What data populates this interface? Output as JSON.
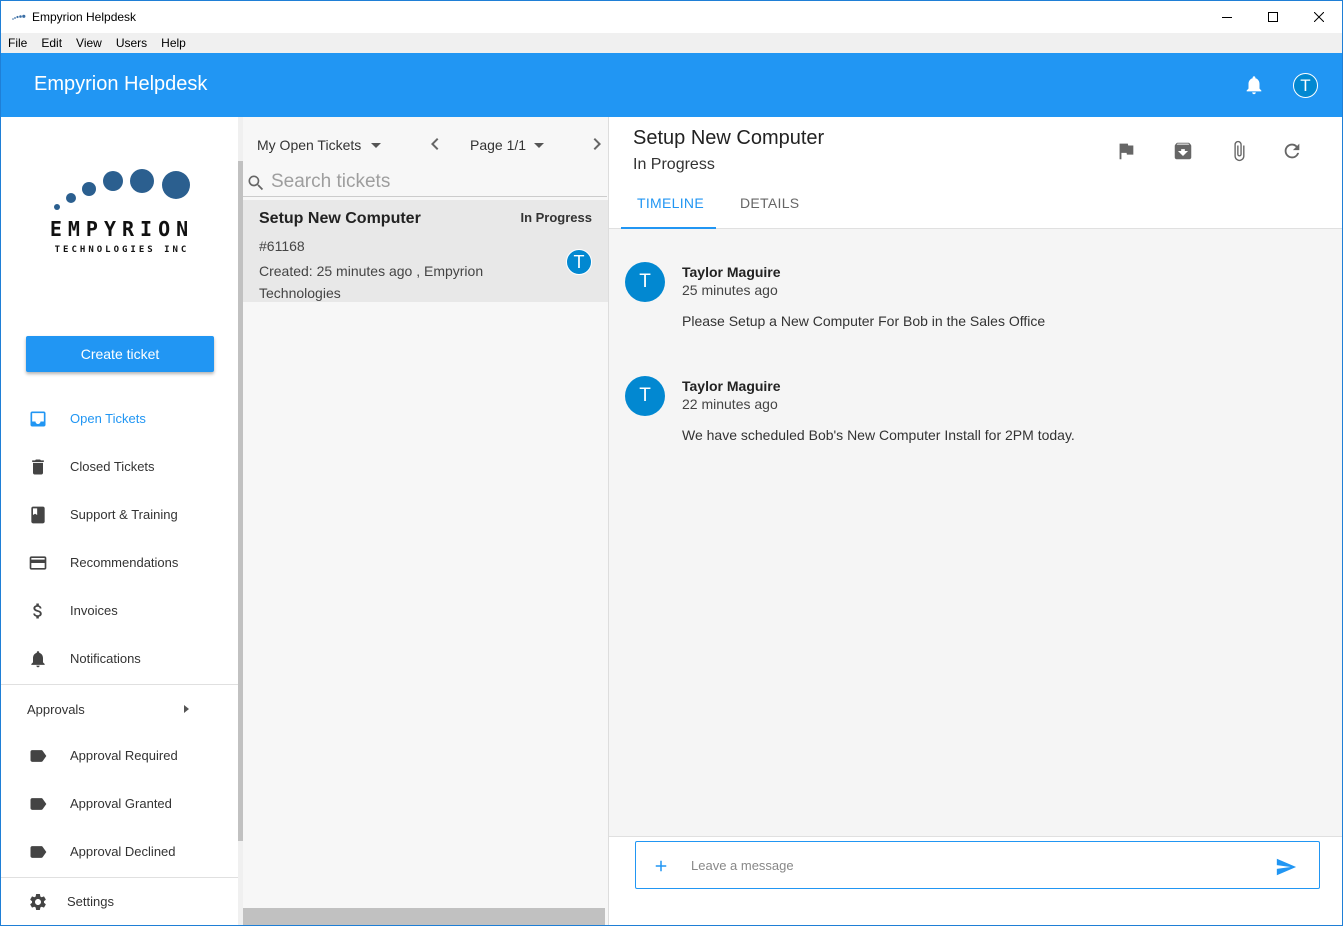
{
  "window": {
    "title": "Empyrion Helpdesk"
  },
  "menu": [
    "File",
    "Edit",
    "View",
    "Users",
    "Help"
  ],
  "appbar": {
    "title": "Empyrion Helpdesk",
    "avatar_letter": "T",
    "bell_icon": "bell-icon"
  },
  "logo": {
    "word": "EMPYRION",
    "sub": "TECHNOLOGIES INC"
  },
  "sidebar": {
    "create_label": "Create ticket",
    "items": [
      {
        "label": "Open Tickets",
        "icon": "inbox-icon",
        "active": true
      },
      {
        "label": "Closed Tickets",
        "icon": "trash-icon"
      },
      {
        "label": "Support & Training",
        "icon": "book-icon"
      },
      {
        "label": "Recommendations",
        "icon": "credit-card-icon"
      },
      {
        "label": "Invoices",
        "icon": "dollar-icon"
      },
      {
        "label": "Notifications",
        "icon": "bell-icon"
      }
    ],
    "approvals_label": "Approvals",
    "approvals": [
      {
        "label": "Approval Required",
        "icon": "label-icon"
      },
      {
        "label": "Approval Granted",
        "icon": "label-icon"
      },
      {
        "label": "Approval Declined",
        "icon": "label-icon"
      }
    ],
    "settings_label": "Settings"
  },
  "list": {
    "filter": "My Open Tickets",
    "page": "Page 1/1",
    "search_placeholder": "Search tickets",
    "tickets": [
      {
        "title": "Setup New Computer",
        "status": "In Progress",
        "id": "#61168",
        "created": "Created: 25 minutes ago , Empyrion Technologies",
        "assignee_letter": "T"
      }
    ]
  },
  "detail": {
    "title": "Setup New Computer",
    "status": "In Progress",
    "tabs": [
      "TIMELINE",
      "DETAILS"
    ],
    "entries": [
      {
        "avatar_letter": "T",
        "author": "Taylor Maguire",
        "time": "25 minutes ago",
        "message": "Please Setup a New Computer For Bob in the Sales Office"
      },
      {
        "avatar_letter": "T",
        "author": "Taylor Maguire",
        "time": "22 minutes ago",
        "message": "We have scheduled Bob's New Computer Install for 2PM today."
      }
    ],
    "composer_placeholder": "Leave a message"
  },
  "colors": {
    "primary": "#2196f3",
    "avatar": "#0288d1"
  }
}
